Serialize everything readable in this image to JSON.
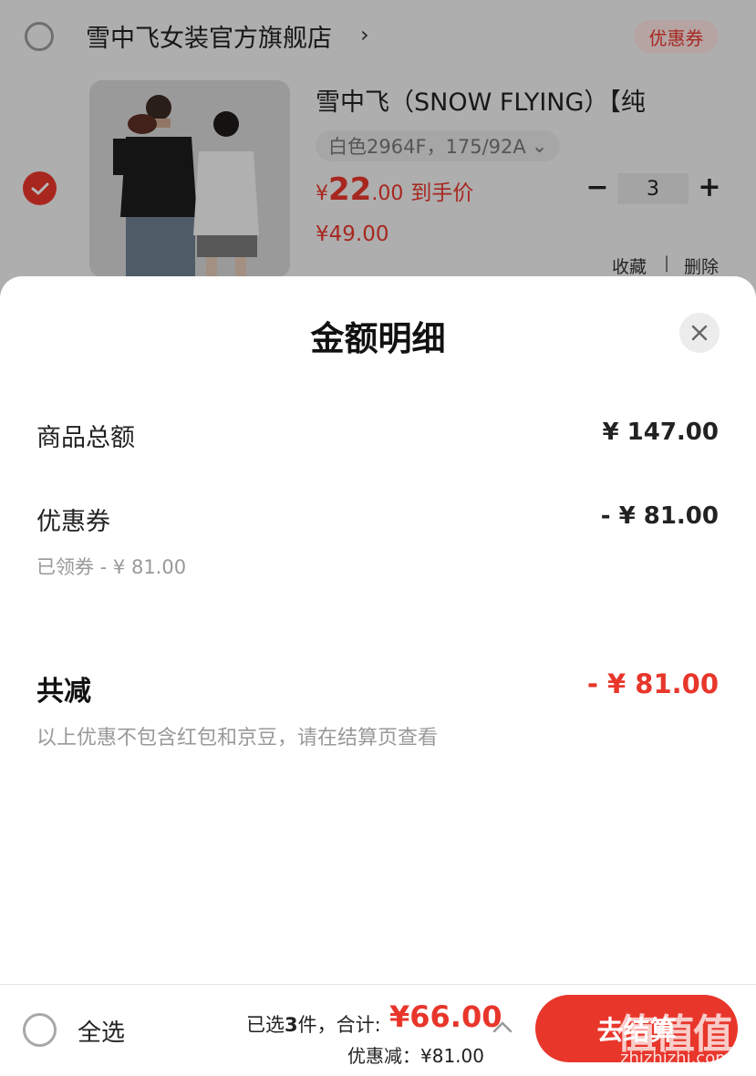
{
  "cart": {
    "store_name": "雪中飞女装官方旗舰店",
    "store_chevron": "›",
    "coupon_badge": "优惠券",
    "product": {
      "title": "雪中飞（SNOW FLYING）【纯",
      "sku": "白色2964F，175/92A",
      "sku_chevron": "⌄",
      "price_symbol": "¥",
      "price_int": "22",
      "price_dec": ".00",
      "price_tag": "到手价",
      "original_price": "¥49.00",
      "quantity": "3",
      "minus": "−",
      "plus": "+",
      "favorite": "收藏",
      "separator": "|",
      "delete": "删除"
    }
  },
  "sheet": {
    "title": "金额明细",
    "rows": {
      "goods_total_label": "商品总额",
      "goods_total_value": "¥ 147.00",
      "coupon_label": "优惠券",
      "coupon_value": "- ¥ 81.00",
      "coupon_sub": "已领券 - ¥ 81.00"
    },
    "total_label": "共减",
    "total_value": "- ¥ 81.00",
    "note": "以上优惠不包含红包和京豆，请在结算页查看"
  },
  "bottom_bar": {
    "select_all": "全选",
    "selected_prefix": "已选",
    "selected_count": "3",
    "selected_suffix": "件，合计:",
    "sum": "¥66.00",
    "discount_line": "优惠减：¥81.00",
    "checkout": "去结算"
  },
  "watermark": {
    "main": "值值值",
    "sub": "zhizhizhi.com"
  },
  "colors": {
    "accent": "#e8362b",
    "muted_text": "#999999",
    "coupon_bg": "#fde3e2"
  }
}
